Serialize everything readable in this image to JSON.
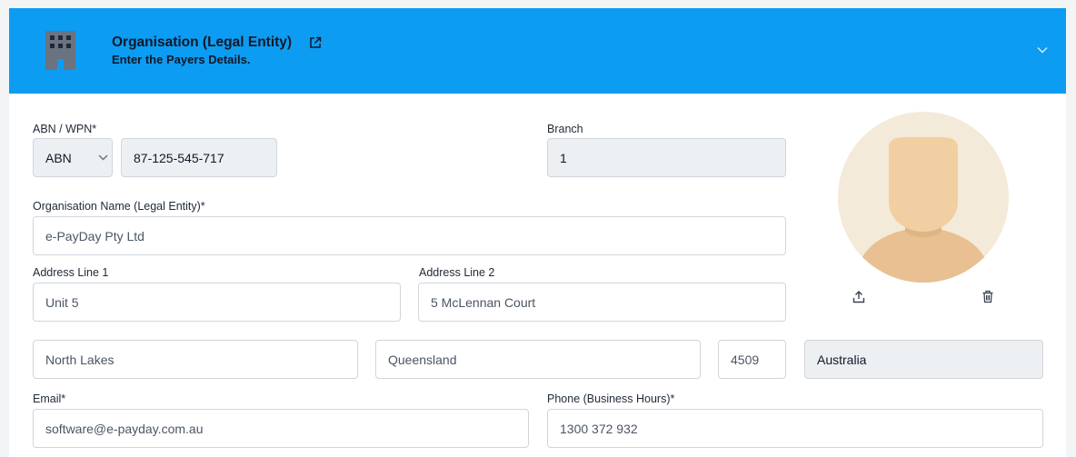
{
  "header": {
    "title": "Organisation (Legal Entity)",
    "subtitle": "Enter the Payers Details."
  },
  "form": {
    "abn_wpn": {
      "label": "ABN / WPN*",
      "type_value": "ABN",
      "number_value": "87-125-545-717"
    },
    "branch": {
      "label": "Branch",
      "value": "1"
    },
    "org_name": {
      "label": "Organisation Name (Legal Entity)*",
      "value": "e-PayDay Pty Ltd"
    },
    "address1": {
      "label": "Address Line 1",
      "value": "Unit 5"
    },
    "address2": {
      "label": "Address Line 2",
      "value": "5 McLennan Court"
    },
    "city": {
      "value": "North Lakes"
    },
    "state": {
      "value": "Queensland"
    },
    "postcode": {
      "value": "4509"
    },
    "country": {
      "value": "Australia"
    },
    "email": {
      "label": "Email*",
      "value": "software@e-payday.com.au"
    },
    "phone": {
      "label": "Phone (Business Hours)*",
      "value": "1300 372 932"
    }
  },
  "icons": {
    "org": "building-icon",
    "external": "external-link-icon",
    "collapse": "chevron-down-icon",
    "upload": "upload-icon",
    "delete": "trash-icon"
  },
  "colors": {
    "header_bg": "#0c9cf2",
    "readonly_bg": "#edf0f3",
    "avatar_bg": "#f4ead9",
    "avatar_skin": "#f2cfa2"
  }
}
